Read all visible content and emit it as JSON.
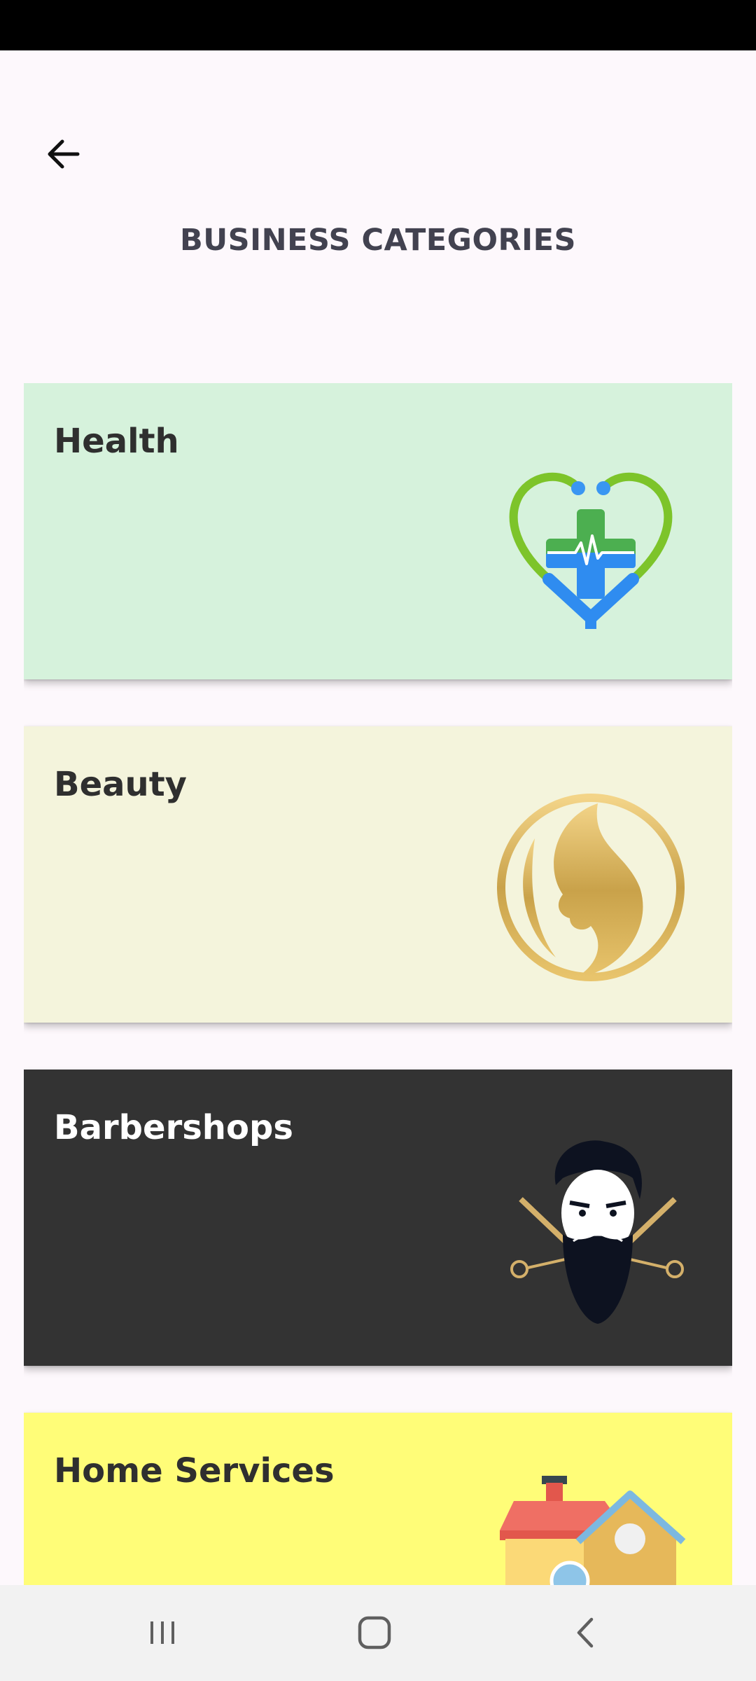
{
  "header": {
    "title": "BUSINESS CATEGORIES",
    "back_icon": "arrow-left-icon"
  },
  "categories": [
    {
      "label": "Health",
      "background": "#d6f2dc",
      "text_color": "#2f2f2f",
      "icon": "heart-stethoscope-cross-icon"
    },
    {
      "label": "Beauty",
      "background": "#f4f4dc",
      "text_color": "#2f2f2f",
      "icon": "woman-face-profile-icon"
    },
    {
      "label": "Barbershops",
      "background": "#333333",
      "text_color": "#ffffff",
      "icon": "bearded-man-scissors-icon"
    },
    {
      "label": "Home Services",
      "background": "#fffd78",
      "text_color": "#2f2f2f",
      "icon": "house-icon"
    }
  ],
  "nav": {
    "recents_icon": "recents-icon",
    "home_icon": "home-icon",
    "back_icon": "back-chevron-icon"
  },
  "colors": {
    "background": "#fdf8fc",
    "title": "#424250",
    "status_bar": "#000000",
    "nav_bar": "#f2f2f2"
  }
}
